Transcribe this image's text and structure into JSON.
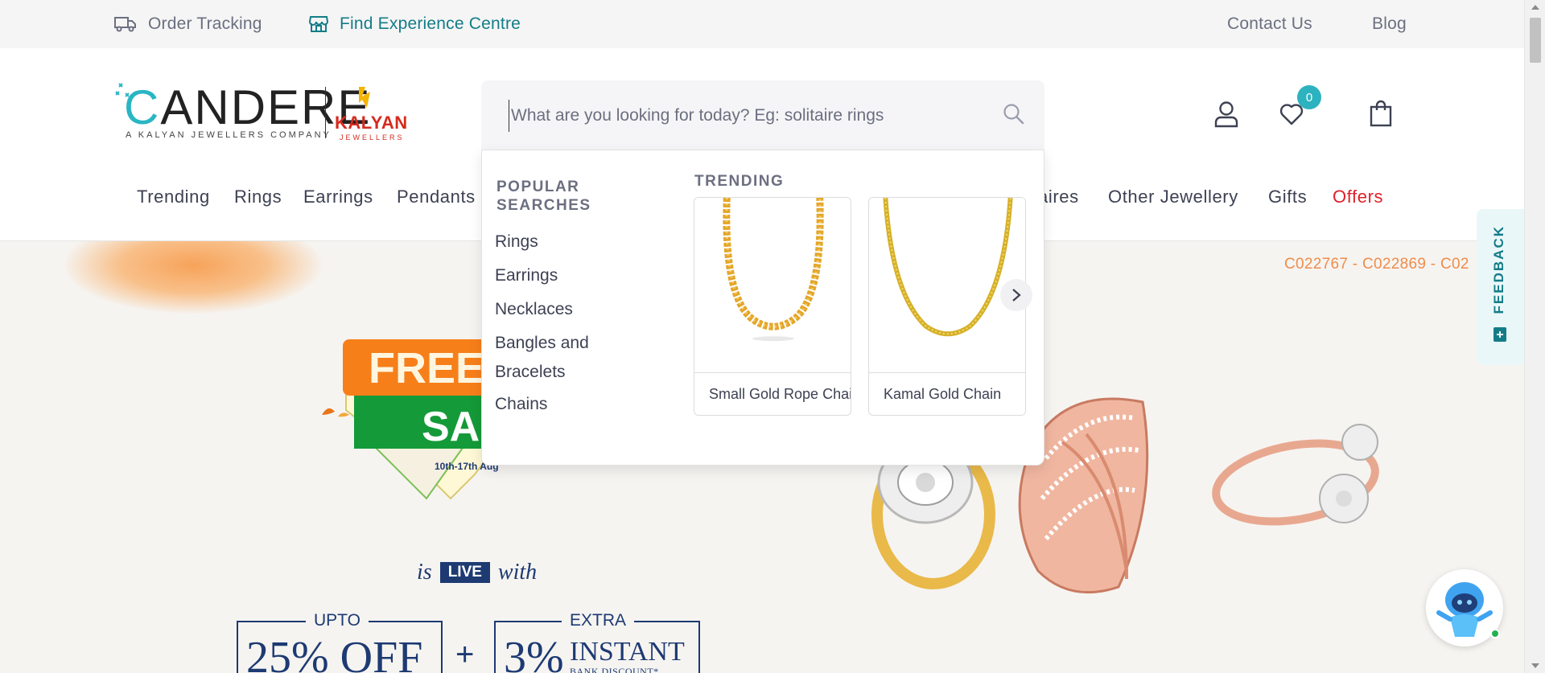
{
  "topbar": {
    "order_tracking": "Order Tracking",
    "find_experience_centre": "Find Experience Centre",
    "contact_us": "Contact Us",
    "blog": "Blog"
  },
  "header": {
    "logo_text": "CANDERE",
    "logo_tagline": "A KALYAN JEWELLERS COMPANY",
    "partner_logo": "KALYAN",
    "partner_sub": "JEWELLERS",
    "wishlist_count": "0",
    "icons": [
      "user-icon",
      "heart-icon",
      "shopping-bag-icon"
    ]
  },
  "search": {
    "placeholder": "What are you looking for today? Eg: solitaire rings",
    "value": ""
  },
  "nav": {
    "items": [
      "Trending",
      "Rings",
      "Earrings",
      "Pendants",
      "aires",
      "Other Jewellery",
      "Gifts",
      "Offers"
    ]
  },
  "popup": {
    "popular_title": "POPULAR SEARCHES",
    "popular_items": [
      "Rings",
      "Earrings",
      "Necklaces",
      "Bangles and Bracelets",
      "Chains"
    ],
    "trending_title": "TRENDING",
    "trending_items": [
      {
        "name": "Small Gold Rope Chai"
      },
      {
        "name": "Kamal Gold Chain"
      }
    ]
  },
  "banner": {
    "codes": "C022767 - C022869 - C02",
    "sale_title_1": "FREED",
    "sale_title_2": "SA",
    "sale_dates": "10th-17th Aug",
    "is": "is",
    "live": "LIVE",
    "with": "with",
    "offer1_cap": "UPTO",
    "offer1_big": "25% OFF",
    "plus": "+",
    "offer2_cap": "EXTRA",
    "offer2_big": "3%",
    "offer2_side": "INSTANT",
    "offer2_side2": "BANK DISCOUNT*"
  },
  "feedback": {
    "label": "FEEDBACK"
  },
  "colors": {
    "brand_teal": "#2cb3bf",
    "offers_red": "#e0202a",
    "navy": "#1d3a72"
  }
}
